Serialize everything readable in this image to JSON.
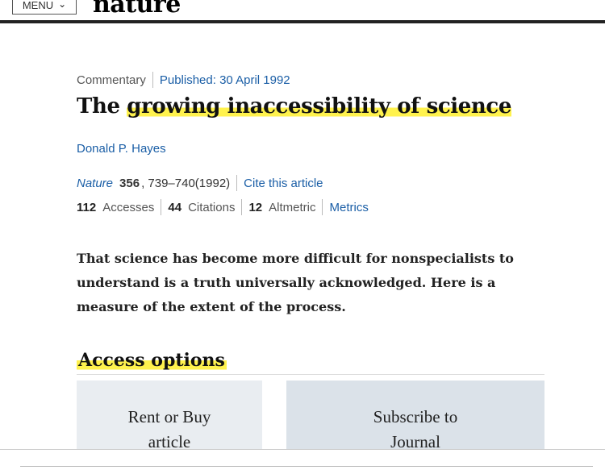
{
  "header": {
    "menu_label": "MENU",
    "menu_icon": "chevron-down-icon",
    "brand": "nature"
  },
  "article": {
    "type": "Commentary",
    "published": "Published: 30 April 1992",
    "title_start": "The ",
    "title_highlight": "growing inaccessibility of science",
    "title_end": "",
    "author": "Donald P. Hayes",
    "journal": "Nature",
    "volume": "356",
    "pages_year": ", 739–740(1992)",
    "cite_label": "Cite this article",
    "abstract": "That science has become more difficult for nonspecialists to understand is a truth universally acknowledged. Here is a measure of the extent of the process."
  },
  "metrics": {
    "accesses_count": "112",
    "accesses_label": "Accesses",
    "citations_count": "44",
    "citations_label": "Citations",
    "altmetric_count": "12",
    "altmetric_label": "Altmetric",
    "metrics_link": "Metrics"
  },
  "access": {
    "heading": "Access options",
    "options": [
      {
        "line1": "Rent or Buy",
        "line2": "article"
      },
      {
        "line1": "Subscribe to",
        "line2": "Journal"
      }
    ]
  },
  "colors": {
    "link": "#1a5ea6",
    "highlight": "#fff24d",
    "card": "#e6ebf0"
  }
}
